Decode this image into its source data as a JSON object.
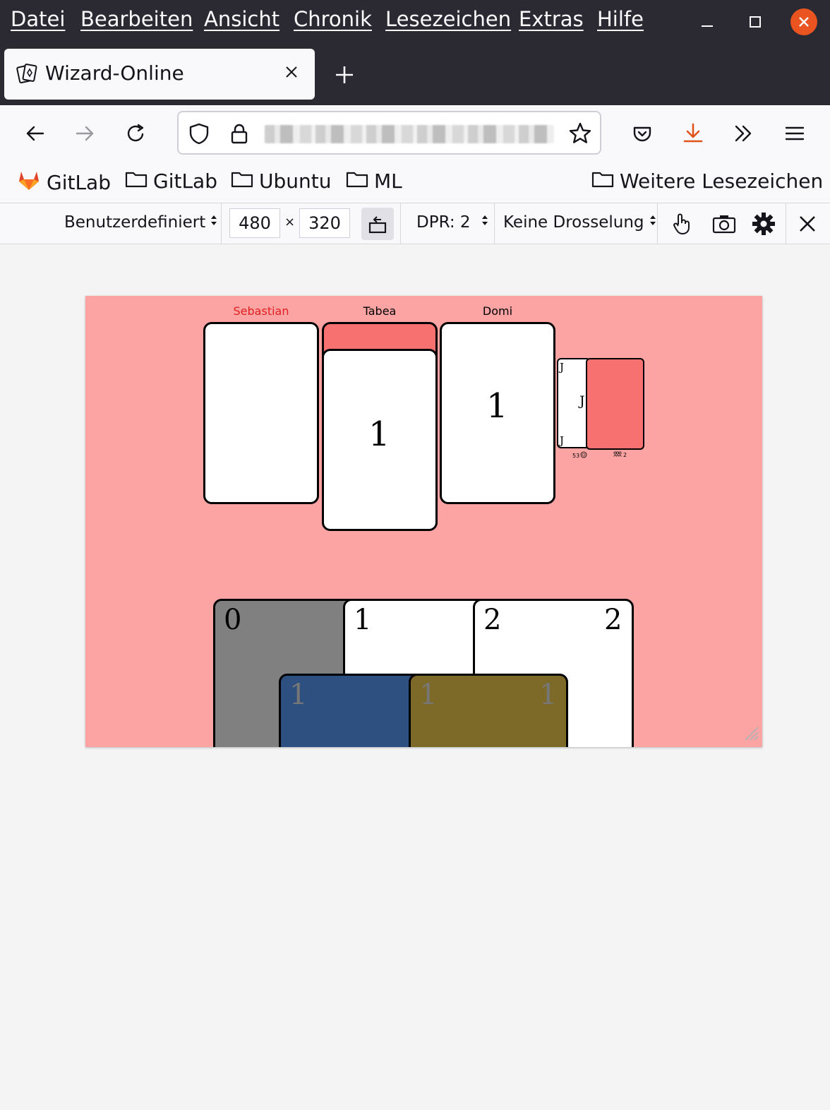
{
  "menubar": {
    "items": [
      "Datei",
      "Bearbeiten",
      "Ansicht",
      "Chronik",
      "Lesezeichen",
      "Extras",
      "Hilfe"
    ]
  },
  "tab": {
    "title": "Wizard-Online"
  },
  "bookmarks": {
    "items": [
      "GitLab",
      "GitLab",
      "Ubuntu",
      "ML"
    ],
    "other": "Weitere Lesezeichen"
  },
  "rdm": {
    "device": "Benutzerdefiniert",
    "width": "480",
    "times": "×",
    "height": "320",
    "dpr": "DPR: 2",
    "throttle": "Keine Drosselung"
  },
  "game": {
    "players": [
      {
        "name": "Sebastian",
        "bid": "",
        "color": "#e02020"
      },
      {
        "name": "Tabea",
        "bid": "1",
        "color": "#000000"
      },
      {
        "name": "Domi",
        "bid": "1",
        "color": "#000000"
      }
    ],
    "trump_card": {
      "corner_top": "J",
      "center": "J",
      "corner_bottom": "J"
    },
    "deck_info": {
      "left": "53",
      "right": "2"
    },
    "hand": [
      {
        "value": "0",
        "color": "#808080"
      },
      {
        "value": "1",
        "color": "#ffffff"
      },
      {
        "value": "2",
        "value_right": "2",
        "color": "#ffffff"
      },
      {
        "value": "1",
        "color": "#2d5080"
      },
      {
        "value": "1",
        "value_right": "1",
        "color": "#7d6a28"
      }
    ],
    "colors": {
      "table": "#fca4a4",
      "card_back": "#f87171"
    }
  }
}
